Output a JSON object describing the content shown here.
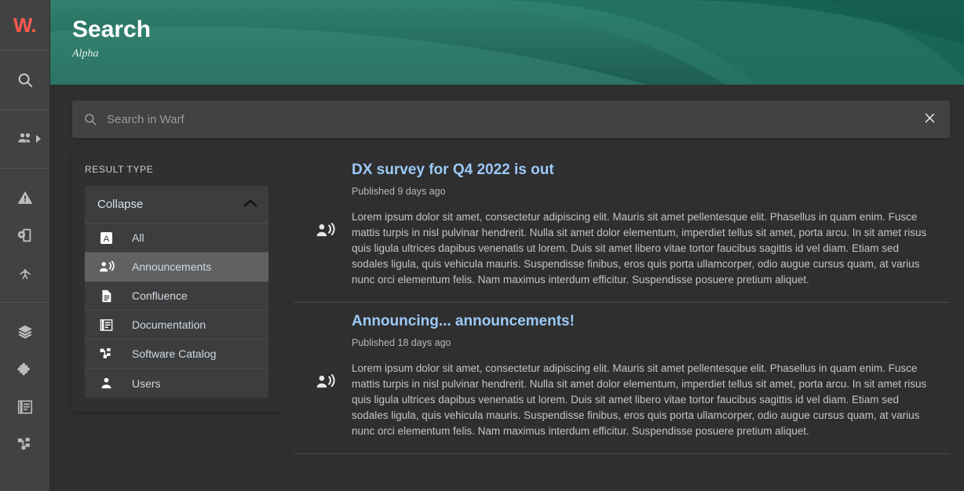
{
  "sidebar": {
    "logo": "W.",
    "items": [
      {
        "name": "search",
        "icon": "search-icon",
        "expandable": false
      },
      {
        "name": "groups",
        "icon": "people-icon",
        "expandable": true
      },
      {
        "name": "alerts",
        "icon": "warning-triangle-icon",
        "expandable": false
      },
      {
        "name": "devices",
        "icon": "device-settings-icon",
        "expandable": false
      },
      {
        "name": "broadcast",
        "icon": "radar-icon",
        "expandable": false
      },
      {
        "name": "layers",
        "icon": "layers-icon",
        "expandable": false
      },
      {
        "name": "plugins",
        "icon": "puzzle-icon",
        "expandable": false
      },
      {
        "name": "documentation",
        "icon": "docs-icon",
        "expandable": false
      },
      {
        "name": "software-catalog",
        "icon": "catalog-tree-icon",
        "expandable": false
      }
    ]
  },
  "header": {
    "title": "Search",
    "subtitle": "Alpha",
    "colors": {
      "gradient_top": "#2f7a6b",
      "gradient_bottom": "#1f6153"
    }
  },
  "search": {
    "value": "",
    "placeholder": "Search in Warf",
    "clear_label": "✕"
  },
  "filters": {
    "section_label": "RESULT TYPE",
    "collapse_label": "Collapse",
    "collapsed": false,
    "options": [
      {
        "label": "All",
        "icon": "letter-a-icon",
        "selected": false
      },
      {
        "label": "Announcements",
        "icon": "announcement-icon",
        "selected": true
      },
      {
        "label": "Confluence",
        "icon": "document-icon",
        "selected": false
      },
      {
        "label": "Documentation",
        "icon": "docs-stack-icon",
        "selected": false
      },
      {
        "label": "Software Catalog",
        "icon": "catalog-tree-icon",
        "selected": false
      },
      {
        "label": "Users",
        "icon": "person-icon",
        "selected": false
      }
    ]
  },
  "results": [
    {
      "title": "DX survey for Q4 2022 is out",
      "meta": "Published 9 days ago",
      "icon": "announcement-icon",
      "body": "Lorem ipsum dolor sit amet, consectetur adipiscing elit. Mauris sit amet pellentesque elit. Phasellus in quam enim. Fusce mattis turpis in nisl pulvinar hendrerit. Nulla sit amet dolor elementum, imperdiet tellus sit amet, porta arcu. In sit amet risus quis ligula ultrices dapibus venenatis ut lorem. Duis sit amet libero vitae tortor faucibus sagittis id vel diam. Etiam sed sodales ligula, quis vehicula mauris. Suspendisse finibus, eros quis porta ullamcorper, odio augue cursus quam, at varius nunc orci elementum felis. Nam maximus interdum efficitur. Suspendisse posuere pretium aliquet."
    },
    {
      "title": "Announcing... announcements!",
      "meta": "Published 18 days ago",
      "icon": "announcement-icon",
      "body": "Lorem ipsum dolor sit amet, consectetur adipiscing elit. Mauris sit amet pellentesque elit. Phasellus in quam enim. Fusce mattis turpis in nisl pulvinar hendrerit. Nulla sit amet dolor elementum, imperdiet tellus sit amet, porta arcu. In sit amet risus quis ligula ultrices dapibus venenatis ut lorem. Duis sit amet libero vitae tortor faucibus sagittis id vel diam. Etiam sed sodales ligula, quis vehicula mauris. Suspendisse finibus, eros quis porta ullamcorper, odio augue cursus quam, at varius nunc orci elementum felis. Nam maximus interdum efficitur. Suspendisse posuere pretium aliquet."
    }
  ],
  "colors": {
    "accent_logo": "#f4584f",
    "link": "#9cc9f7",
    "sidebar_bg": "#424242",
    "panel_bg": "#303030",
    "card_bg": "#3d3d3d",
    "selected_row": "#616161",
    "page_bg": "#2f2f2f"
  }
}
